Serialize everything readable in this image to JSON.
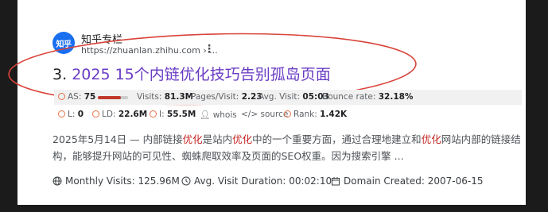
{
  "result": {
    "site_name": "知乎专栏",
    "logo_text": "知乎",
    "url": "https://zhuanlan.zhihu.com › ...",
    "title_number": "3.",
    "title_text": "2025 15个内链优化技巧告别孤岛页面",
    "snippet_date": "2025年5月14日",
    "snippet_parts": {
      "p1": " — 内部链接",
      "hl1": "优化",
      "p2": "是站内",
      "hl2": "优化",
      "p3": "中的一个重要方面，通过合理地建立和",
      "hl3": "优化",
      "p4": "网站内部的链接结构，能够提升网站的可见性、蜘蛛爬取效率及页面的SEO权重。因为搜索引擎 ..."
    }
  },
  "metrics": {
    "as_label": "AS:",
    "as_value": "75",
    "as_progress": 0.75,
    "visits_label": "Visits:",
    "visits_value": "81.3M",
    "pages_label": "Pages/Visit:",
    "pages_value": "2.23",
    "avg_label": "Avg. Visit:",
    "avg_value": "05:03",
    "bounce_label": "Bounce rate:",
    "bounce_value": "32.18%",
    "l_label": "L:",
    "l_value": "0",
    "ld_label": "LD:",
    "ld_value": "22.6M",
    "i_label": "I:",
    "i_value": "55.5M",
    "whois": "whois",
    "source": "source",
    "rank_label": "Rank:",
    "rank_value": "1.42K"
  },
  "stats": {
    "monthly_visits": "Monthly Visits: 125.96M",
    "avg_duration": "Avg. Visit Duration: 00:02:10",
    "domain_created": "Domain Created: 2007-06-15"
  },
  "colors": {
    "title_link": "#6a3cc4",
    "highlight": "#c5221f",
    "annotation": "#d9433a",
    "logo": "#1a6ff0"
  }
}
